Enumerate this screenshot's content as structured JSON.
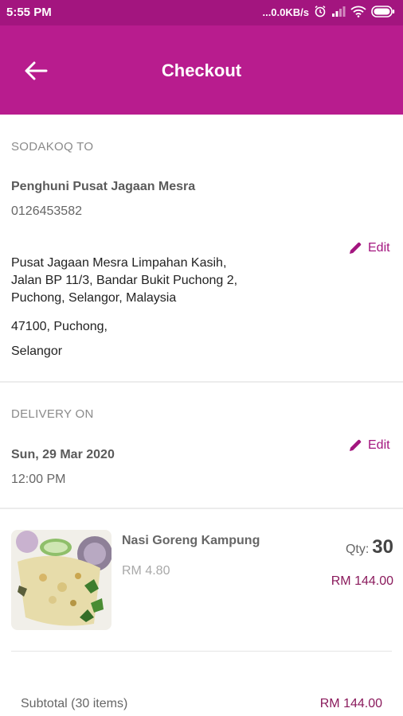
{
  "status_bar": {
    "time": "5:55 PM",
    "network_speed": "...0.0KB/s",
    "icons": [
      "alarm-icon",
      "signal-icon",
      "wifi-icon",
      "battery-icon"
    ]
  },
  "header": {
    "title": "Checkout"
  },
  "delivery_address": {
    "section_label": "SODAKOQ TO",
    "name": "Penghuni Pusat Jagaan Mesra",
    "phone": "0126453582",
    "address_line_1": "Pusat Jagaan Mesra Limpahan Kasih,",
    "address_line_2": "Jalan BP 11/3, Bandar Bukit Puchong 2,",
    "address_line_3": "Puchong, Selangor, Malaysia",
    "postcode_city": "47100, Puchong,",
    "state": "Selangor",
    "edit_label": "Edit"
  },
  "delivery_time": {
    "section_label": "DELIVERY ON",
    "date": "Sun, 29 Mar 2020",
    "time": "12:00 PM",
    "edit_label": "Edit"
  },
  "cart_item": {
    "name": "Nasi Goreng Kampung",
    "unit_price": "RM 4.80",
    "qty_label": "Qty:",
    "qty_value": "30",
    "line_total": "RM 144.00"
  },
  "summary": {
    "subtotal_label": "Subtotal (30 items)",
    "subtotal_value": "RM 144.00"
  },
  "colors": {
    "accent": "#b81c8e",
    "status_bar": "#a3157f",
    "price_text": "#8a1a5c"
  }
}
